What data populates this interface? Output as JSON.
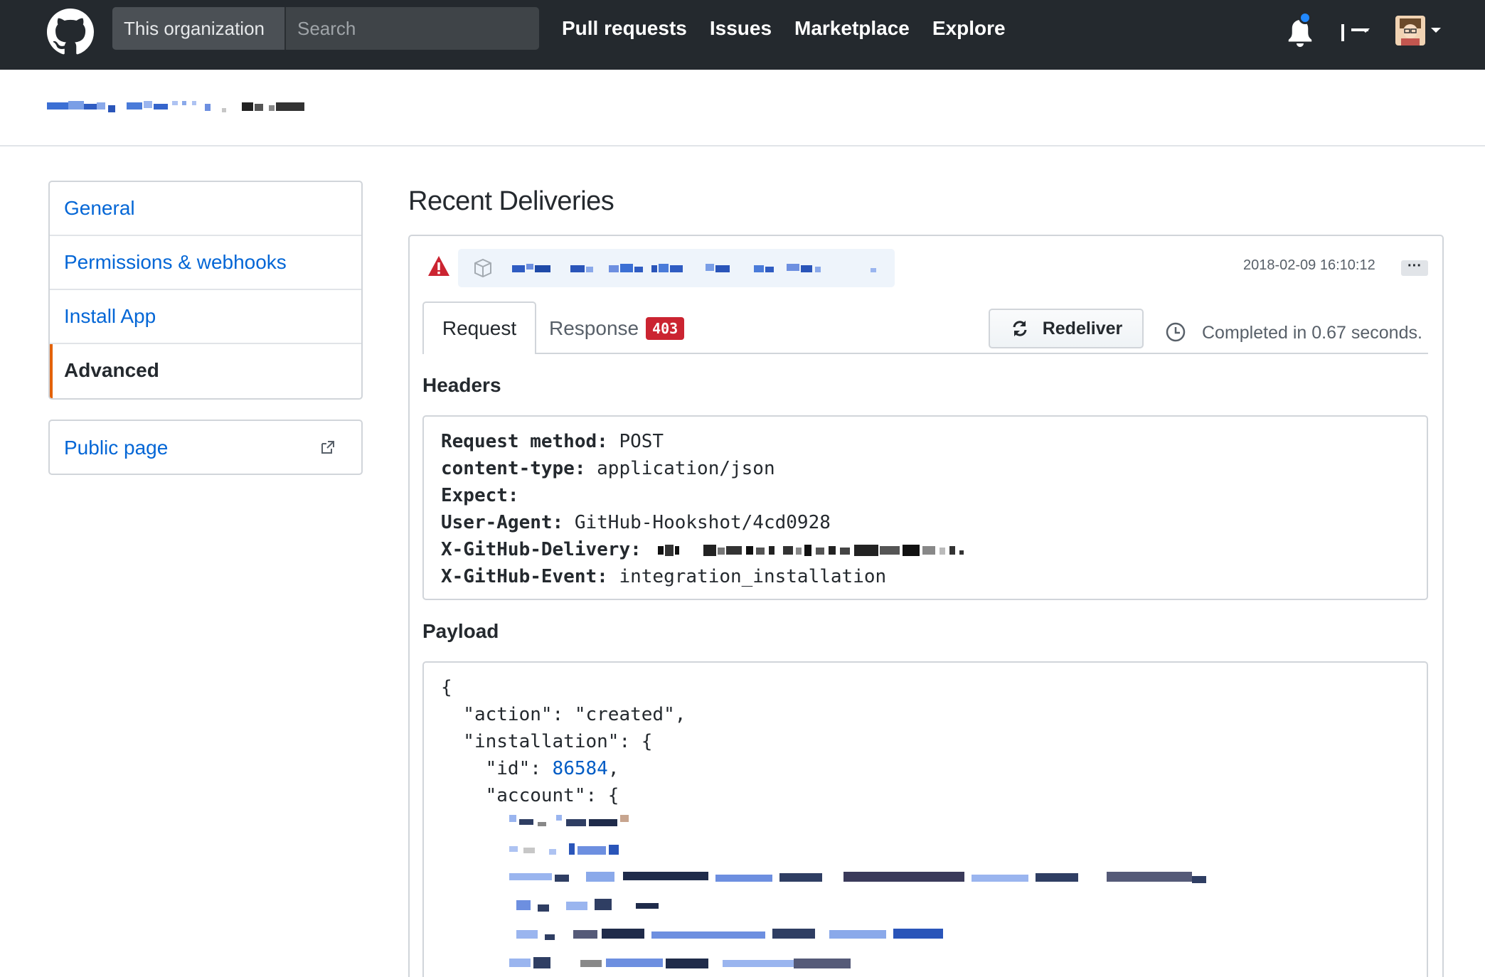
{
  "header": {
    "search_scope": "This organization",
    "search_placeholder": "Search",
    "nav": [
      "Pull requests",
      "Issues",
      "Marketplace",
      "Explore"
    ],
    "notification_dot_color": "#2188ff",
    "background": "#24292e"
  },
  "sidebar": {
    "items": [
      {
        "label": "General",
        "selected": false
      },
      {
        "label": "Permissions & webhooks",
        "selected": false
      },
      {
        "label": "Install App",
        "selected": false
      },
      {
        "label": "Advanced",
        "selected": true
      }
    ],
    "public_page": "Public page",
    "selected_accent": "#e36209"
  },
  "main": {
    "title": "Recent Deliveries",
    "delivery": {
      "status_icon": "alert-icon",
      "timestamp": "2018-02-09 16:10:12",
      "more_label": "···"
    },
    "tabs": {
      "request": "Request",
      "response": "Response",
      "response_status": "403"
    },
    "redeliver_label": "Redeliver",
    "completed_text": "Completed in 0.67 seconds.",
    "headers_label": "Headers",
    "headers": [
      {
        "key": "Request method:",
        "value": "POST"
      },
      {
        "key": "content-type:",
        "value": "application/json"
      },
      {
        "key": "Expect:",
        "value": ""
      },
      {
        "key": "User-Agent:",
        "value": "GitHub-Hookshot/4cd0928"
      },
      {
        "key": "X-GitHub-Delivery:",
        "value": ""
      },
      {
        "key": "X-GitHub-Event:",
        "value": "integration_installation"
      }
    ],
    "payload_label": "Payload",
    "payload": {
      "open_brace": "{",
      "action_line": "  \"action\": \"created\",",
      "installation_line": "  \"installation\": {",
      "id_key": "    \"id\": ",
      "id_value": "86584",
      "account_line": "    \"account\": {"
    }
  }
}
